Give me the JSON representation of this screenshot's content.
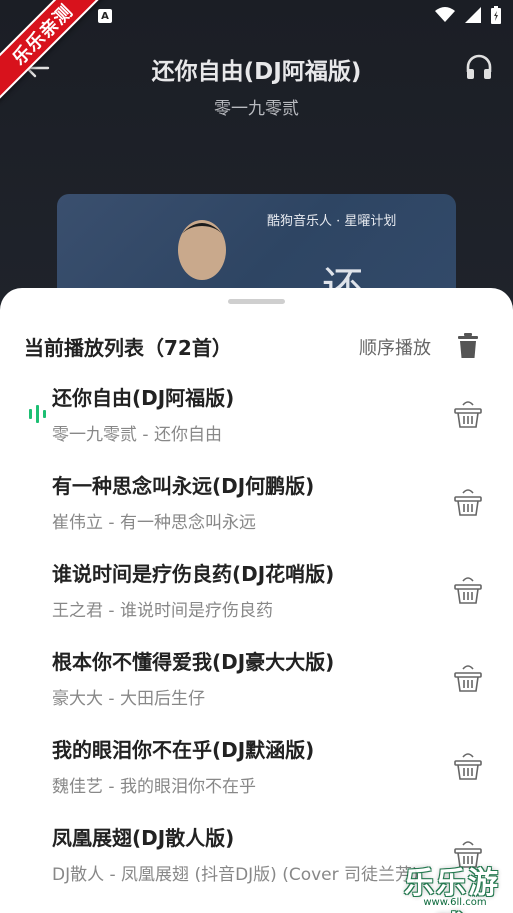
{
  "status_bar": {
    "notification_letter": "A"
  },
  "badge": {
    "text": "乐乐亲测"
  },
  "player": {
    "title": "还你自由(DJ阿福版)",
    "artist": "零一九零贰",
    "album": {
      "caption": "酷狗音乐人 · 星曜计划",
      "big_char": "还"
    }
  },
  "playlist": {
    "title": "当前播放列表（72首）",
    "play_mode": "顺序播放",
    "songs": [
      {
        "title": "还你自由(DJ阿福版)",
        "subtitle": "零一九零贰 - 还你自由",
        "playing": true
      },
      {
        "title": "有一种思念叫永远(DJ何鹏版)",
        "subtitle": "崔伟立 - 有一种思念叫永远",
        "playing": false
      },
      {
        "title": "谁说时间是疗伤良药(DJ花哨版)",
        "subtitle": "王之君 - 谁说时间是疗伤良药",
        "playing": false
      },
      {
        "title": "根本你不懂得爱我(DJ豪大大版)",
        "subtitle": "豪大大 - 大田后生仔",
        "playing": false
      },
      {
        "title": "我的眼泪你不在乎(DJ默涵版)",
        "subtitle": "魏佳艺 - 我的眼泪你不在乎",
        "playing": false
      },
      {
        "title": "凤凰展翅(DJ散人版)",
        "subtitle": "DJ散人 - 凤凰展翅 (抖音DJ版) (Cover 司徒兰芳)",
        "playing": false
      }
    ]
  },
  "watermark": {
    "text": "乐乐游戏",
    "url": "www.6ll.com"
  },
  "colors": {
    "accent": "#1dbf73",
    "badge": "#d8121c",
    "sheet_bg": "#ffffff"
  },
  "icons": {
    "back": "arrow-left-icon",
    "headphone": "headphone-icon",
    "trash": "trash-icon",
    "delete_item": "basket-delete-icon",
    "playing": "equalizer-icon"
  }
}
